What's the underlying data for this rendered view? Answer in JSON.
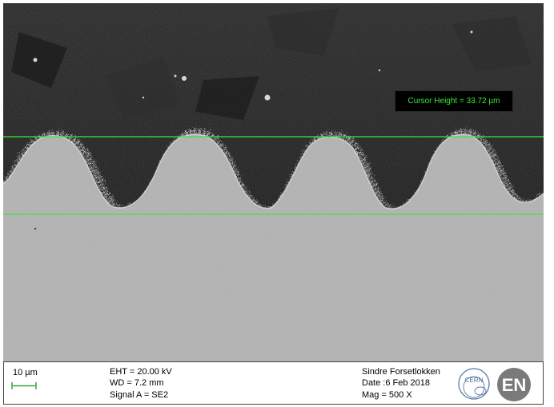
{
  "measurement": {
    "cursor_height": "Cursor Height = 33.72 µm"
  },
  "info_bar": {
    "scale_label": "10 µm",
    "eht": "EHT = 20.00 kV",
    "wd": "WD =  7.2 mm",
    "signal": "Signal A = SE2",
    "operator": "Sindre Forsetlokken",
    "date": "Date :6 Feb 2018",
    "mag": "Mag =    500 X",
    "logo_cern_text": "CERN",
    "logo_en_text": "EN"
  },
  "colors": {
    "overlay_green": "#39e83a",
    "background_dark": "#1c1c1c",
    "substrate_gray": "#b6b6b6"
  }
}
